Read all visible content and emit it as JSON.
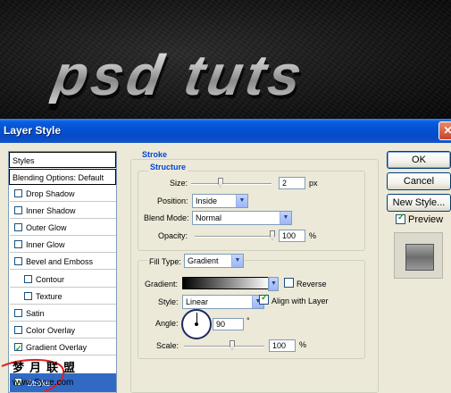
{
  "header_logo_text": "psd tuts",
  "dialog": {
    "title": "Layer Style",
    "close_glyph": "✕"
  },
  "style_list": {
    "header": "Styles",
    "blending_options": "Blending Options: Default",
    "items": [
      {
        "label": "Drop Shadow",
        "checked": false,
        "indent": false
      },
      {
        "label": "Inner Shadow",
        "checked": false,
        "indent": false
      },
      {
        "label": "Outer Glow",
        "checked": false,
        "indent": false
      },
      {
        "label": "Inner Glow",
        "checked": false,
        "indent": false
      },
      {
        "label": "Bevel and Emboss",
        "checked": false,
        "indent": false
      },
      {
        "label": "Contour",
        "checked": false,
        "indent": true
      },
      {
        "label": "Texture",
        "checked": false,
        "indent": true
      },
      {
        "label": "Satin",
        "checked": false,
        "indent": false
      },
      {
        "label": "Color Overlay",
        "checked": false,
        "indent": false
      },
      {
        "label": "Gradient Overlay",
        "checked": true,
        "indent": false
      }
    ],
    "selected_item": "Stroke"
  },
  "stroke": {
    "legend": "Stroke",
    "structure_legend": "Structure",
    "size_label": "Size:",
    "size_value": "2",
    "size_unit": "px",
    "size_level": 0.02,
    "position_label": "Position:",
    "position_value": "Inside",
    "blend_label": "Blend Mode:",
    "blend_value": "Normal",
    "opacity_label": "Opacity:",
    "opacity_value": "100",
    "opacity_unit": "%",
    "fill_type_label": "Fill Type:",
    "fill_type_value": "Gradient",
    "gradient_label": "Gradient:",
    "reverse_label": "Reverse",
    "reverse_checked": false,
    "style_label": "Style:",
    "style_value": "Linear",
    "align_label": "Align with Layer",
    "align_checked": true,
    "angle_label": "Angle:",
    "angle_value": "90",
    "angle_unit": "°",
    "scale_label": "Scale:",
    "scale_value": "100",
    "scale_unit": "%"
  },
  "buttons": {
    "ok": "OK",
    "cancel": "Cancel",
    "new_style": "New Style...",
    "preview_label": "Preview",
    "preview_checked": true
  },
  "watermark": {
    "line1": "梦月联盟",
    "line2": "www.Syue.com"
  },
  "colors": {
    "titlebar": "#0552d4",
    "dialog_bg": "#ece9d8",
    "selection": "#316ac5",
    "legend_text": "#0046d5"
  }
}
